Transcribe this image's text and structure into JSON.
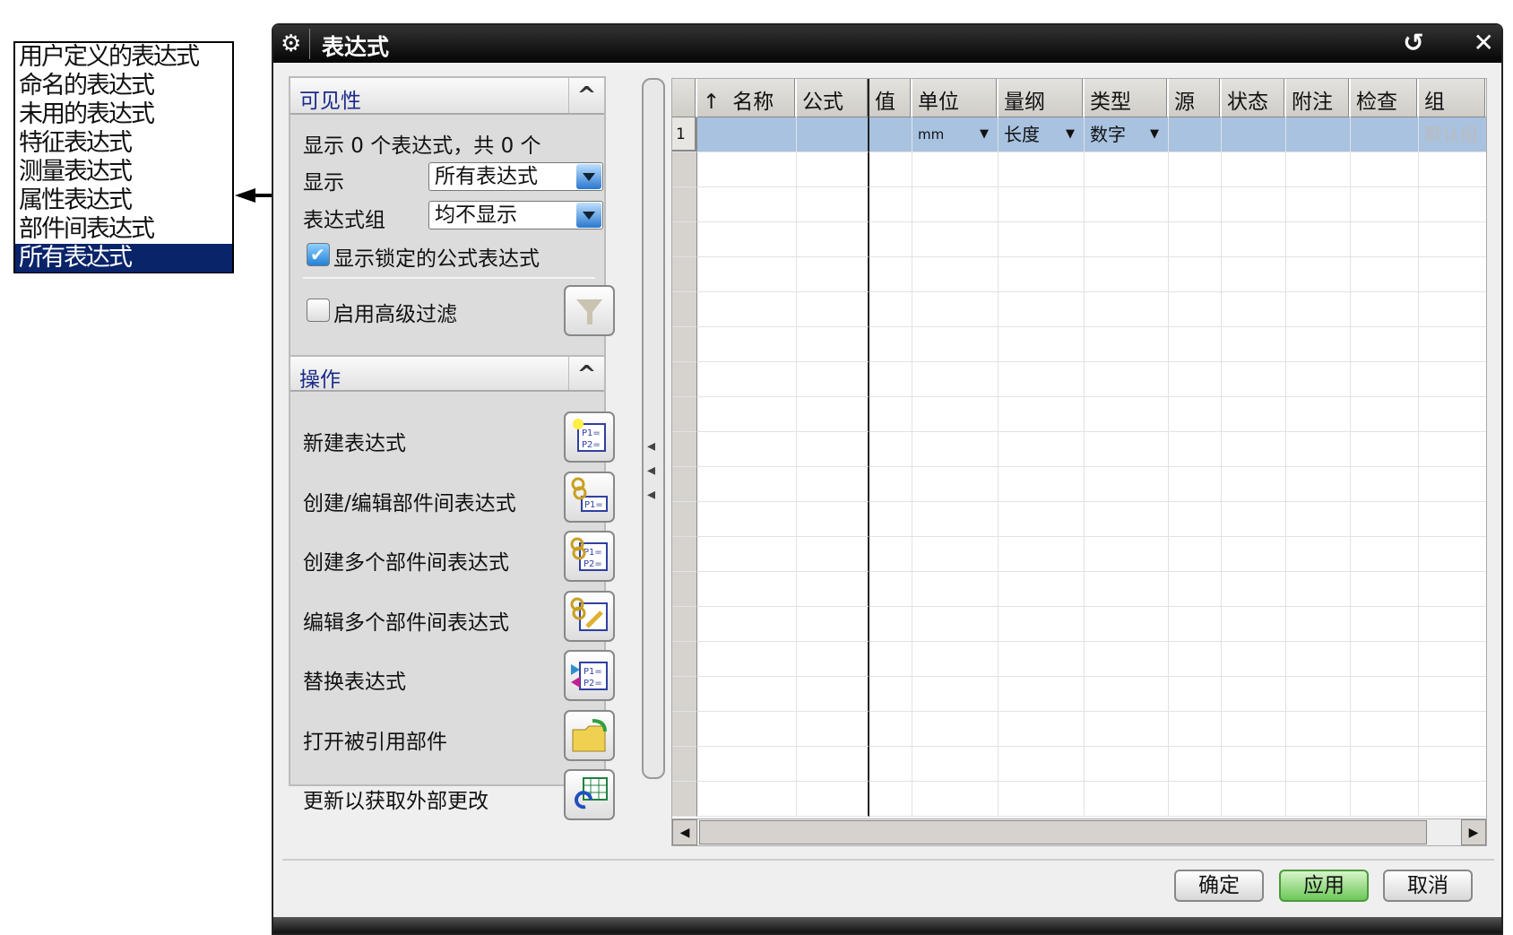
{
  "dropdown_list": {
    "items": [
      "用户定义的表达式",
      "命名的表达式",
      "未用的表达式",
      "特征表达式",
      "测量表达式",
      "属性表达式",
      "部件间表达式",
      "所有表达式"
    ],
    "selected_index": 7
  },
  "dialog": {
    "title": "表达式",
    "title_buttons": {
      "reset": "↺",
      "close": "✕"
    },
    "visibility": {
      "header": "可见性",
      "count_text": "显示 0 个表达式，共 0 个",
      "show_label": "显示",
      "show_value": "所有表达式",
      "group_label": "表达式组",
      "group_value": "均不显示",
      "show_locked_label": "显示锁定的公式表达式",
      "show_locked_checked": true,
      "advanced_filter_label": "启用高级过滤",
      "advanced_filter_checked": false
    },
    "operations": {
      "header": "操作",
      "items": [
        {
          "label": "新建表达式",
          "icon": "new-expression-icon"
        },
        {
          "label": "创建/编辑部件间表达式",
          "icon": "interpart-expression-icon"
        },
        {
          "label": "创建多个部件间表达式",
          "icon": "create-multiple-interpart-icon"
        },
        {
          "label": "编辑多个部件间表达式",
          "icon": "edit-multiple-interpart-icon"
        },
        {
          "label": "替换表达式",
          "icon": "replace-expression-icon"
        },
        {
          "label": "打开被引用部件",
          "icon": "open-folder-icon"
        },
        {
          "label": "更新以获取外部更改",
          "icon": "update-external-icon"
        }
      ]
    },
    "table": {
      "sort_indicator": "↑",
      "columns": [
        "名称",
        "公式",
        "值",
        "单位",
        "量纲",
        "类型",
        "源",
        "状态",
        "附注",
        "检查",
        "组"
      ],
      "rows": [
        {
          "num": "1",
          "cells": [
            "",
            "",
            "",
            "mm",
            "长度",
            "数字",
            "",
            "",
            "",
            "",
            "默认组"
          ]
        }
      ]
    },
    "buttons": {
      "ok": "确定",
      "apply": "应用",
      "cancel": "取消"
    }
  }
}
